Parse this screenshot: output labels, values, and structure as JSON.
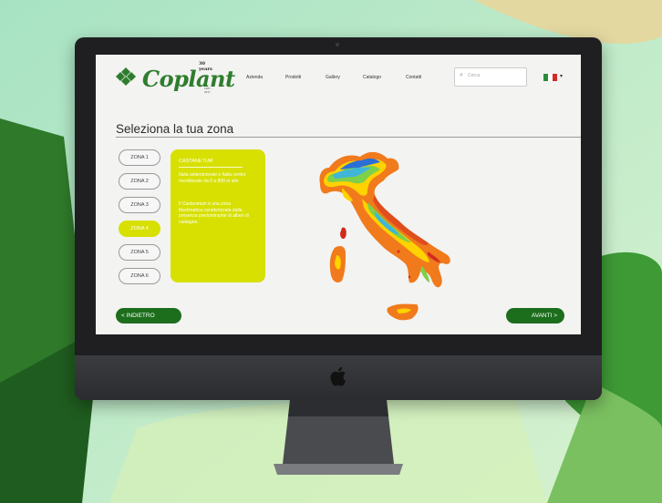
{
  "brand": {
    "name": "Coplant",
    "badge": "30 years",
    "est": "1987 - 2017"
  },
  "nav": {
    "items": [
      "Azienda",
      "Prodotti",
      "Gallery",
      "Catalogo",
      "Contatti"
    ]
  },
  "search": {
    "placeholder": "Cerca"
  },
  "language": {
    "flag": "Italian flag"
  },
  "page": {
    "title": "Seleziona la tua zona"
  },
  "zones": {
    "items": [
      "ZONA 1",
      "ZONA 2",
      "ZONA 3",
      "ZONA 4",
      "ZONA 5",
      "ZONA 6"
    ],
    "active": "ZONA 4"
  },
  "info": {
    "title": "CASTANETUM",
    "para1": "Italia settentrionale e Italia centro meridionale da 0 a 800 m slm",
    "para2": "Il Castanetum è una zona fitoclimatica caratterizzata dalla presenza predominante di alberi di castagno."
  },
  "buttons": {
    "back": "< INDIETRO",
    "next": "AVANTI >"
  },
  "colors": {
    "accent": "#d7e000",
    "button": "#1c6e1c",
    "brand": "#2e7d2e"
  }
}
